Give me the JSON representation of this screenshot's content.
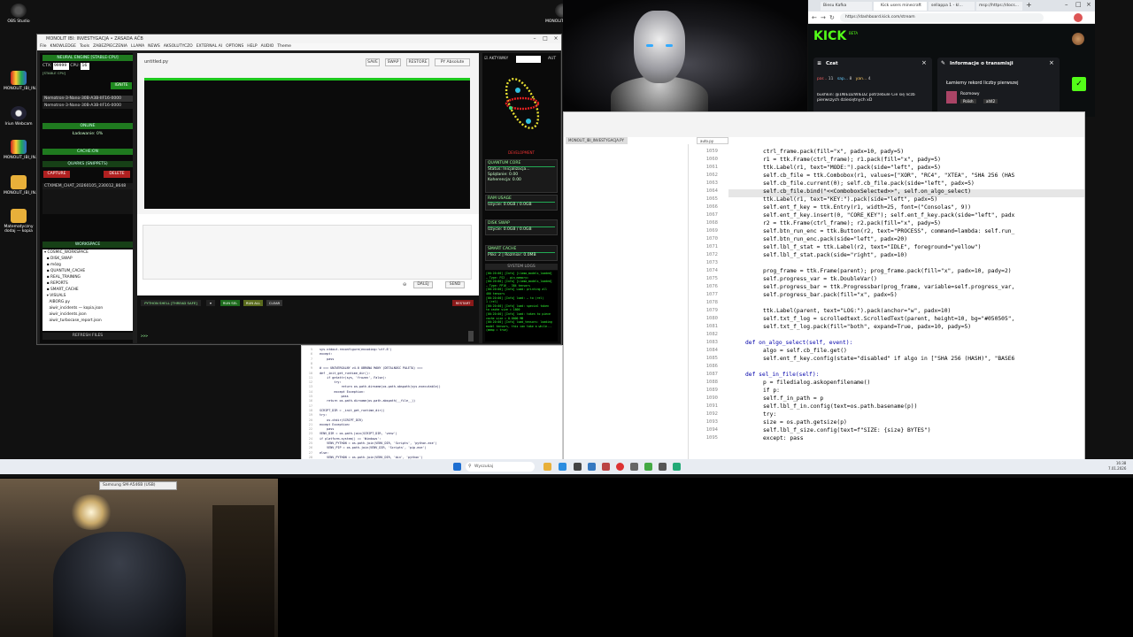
{
  "desktop": {
    "icons": [
      {
        "label": "OBS Studio"
      },
      {
        "label": "MONOLIT_IBI_IN..."
      },
      {
        "label": "Iriun Webcam"
      },
      {
        "label": "MONOLIT_IBI_IN..."
      },
      {
        "label": "MONOLIT_IBI_IN..."
      },
      {
        "label": "Matematyczny dodaj — kopia"
      }
    ],
    "top_icon": {
      "label": "MONOLIT_IBI_IN..."
    }
  },
  "app": {
    "title": "MONOLIT IBI: INVESTYGACJA • ZASADA AČB",
    "menu": [
      "File",
      "KNOWLEDGE",
      "Tools",
      "ZABEZPIECZENIA",
      "LLAMA",
      "NEWS",
      "AKSOLUTYCZO",
      "EXTERNAL AI",
      "OPTIONS",
      "HELP",
      "AUDIO",
      "Theme"
    ],
    "left": {
      "neural_engine": "NEURAL ENGINE [STABLE-CPU]",
      "ctx_label": "CTX:",
      "ctx_value": "99999",
      "cpu_label": "CPU:",
      "cpu_value": "16",
      "stable": "[STABLE CPU]",
      "ignite": "IGNITE",
      "models": [
        "Nemotron-3-Nano-30B-A3B-IIF16-0000",
        "Nemotron-3-Nano-30B-A3B-IIF16-0000"
      ],
      "online": "ONLINE",
      "loading": "Ładowanie: 0%",
      "cache_on": "CACHE:ON",
      "quarks": "QUARKS (SNIPPETS)",
      "capture": "CAPTURE",
      "delete": "DELETE",
      "snippet": "CTXMEM_CHAT_20260105_230012_8648",
      "workspace": "WORKSPACE",
      "tree": [
        "▾ COSMIC_WORKSPACE",
        "  ▪ DISK_SWAP",
        "  ▪ mózg",
        "  ▪ QUANTUM_CACHE",
        "  ▪ REAL_TRAINING",
        "  ▪ REPORTS",
        "  ▪ SMART_CACHE",
        "  ▾ VISUALS",
        "    AIBORG.py",
        "    aiwir_incidents — kopia.json",
        "    aiwir_incidents.json",
        "    aiwir_turbocase_report.json"
      ],
      "refresh": "REFRESH FILES"
    },
    "center": {
      "filename": "untitled.py",
      "buttons": [
        "SAVE",
        "SWAP",
        "RESTORE",
        "PY Absolute"
      ],
      "dalej": "DALEJ",
      "send": "SEND",
      "shell": "PYTHON SHELL [THREAD SAFE]",
      "run_sel": "RUN SEL",
      "run_all": "RUN ALL",
      "clear": "CLEAR",
      "restart": "RESTART",
      "prompt": ">>>"
    },
    "right": {
      "aktywny": "AKTYWNY",
      "aut": "AUT",
      "dev": "DEVELOPMENT",
      "quantum": "QUANTUM CORE",
      "status": "Status: Inicjalizacja...",
      "splatanie": "Splątanie: 0.00",
      "koherencja": "Koherencja: 0.00",
      "ram": "RAM USAGE",
      "ram_val": "Użycie: 0.0GB / 0.0GB",
      "disk": "DISK SWAP",
      "disk_val": "Użycie: 0.0GB / 0.0GB",
      "smart": "SMART CACHE",
      "smart_val": "Pliki: 2 | Rozmiar: 0.0MB",
      "syslog": "SYSTEM LOGS",
      "logs": [
        "[00:20:00] [Info] [Llama_models_loaded]",
        "— Type: FS2 - pin_memory=",
        "[00:20:00] [Info] [Llama_models_loaded]",
        "— Type: FP16 - 384 tensors",
        "[00:20:00] [Info] Load: printing all",
        "400 tensors",
        "[00:20:00] [Info] load: — to (rel)",
        "1 (rel)",
        "[00:20:00] [Info] load: special token",
        "to cache size = 1800",
        "[00:20:00] [Info] load: token to piece",
        "cache size = 0.0000 MB",
        "[00:20:00] [Info] load_tensors: loading",
        "model tensors, this can take a while...",
        "(mmap = true)"
      ]
    }
  },
  "browser": {
    "tabs": [
      "Biesu Kafka",
      "Kick users minecraft",
      "sellappa 1 - kl...",
      "msp://https://docs..."
    ],
    "url": "https://dashboard.kick.com/stream",
    "brand": "KICK",
    "beta": "BETA",
    "chat": "Czat",
    "info": "Informacje o transmisji",
    "chat_users": [
      "par...",
      "11",
      "sap...",
      "8",
      "yan...",
      "4"
    ],
    "chat_msg": "bushkin: @1NIEDZWIEDZ potrzebule Cie się liczb pierwszych dziesiętnych xD",
    "stream_title": "Łamiemy rekord liczby pierwszej",
    "category": "Rozmowy",
    "tag1": "Polish",
    "tag2": "alt42"
  },
  "code": {
    "tab1": "MONOLIT_IBI_INVESTYGACJA.PY",
    "tab2": "auto.py",
    "lines": [
      {
        "n": "1059",
        "t": "ctrl_frame.pack(fill=\"x\", padx=10, pady=5)"
      },
      {
        "n": "1060",
        "t": "r1 = ttk.Frame(ctrl_frame); r1.pack(fill=\"x\", pady=5)"
      },
      {
        "n": "1061",
        "t": "ttk.Label(r1, text=\"MODE:\").pack(side=\"left\", padx=5)"
      },
      {
        "n": "1062",
        "t": "self.cb_file = ttk.Combobox(r1, values=[\"XOR\", \"RC4\", \"XTEA\", \"SHA 256 (HAS"
      },
      {
        "n": "1063",
        "t": "self.cb_file.current(0); self.cb_file.pack(side=\"left\", padx=5)"
      },
      {
        "n": "1064",
        "t": "self.cb_file.bind(\"<<ComboboxSelected>>\", self.on_algo_select)"
      },
      {
        "n": "1065",
        "t": "ttk.Label(r1, text=\"KEY:\").pack(side=\"left\", padx=5)"
      },
      {
        "n": "1066",
        "t": "self.ent_f_key = ttk.Entry(r1, width=25, font=(\"Consolas\", 9))"
      },
      {
        "n": "1067",
        "t": "self.ent_f_key.insert(0, \"CORE_KEY\"); self.ent_f_key.pack(side=\"left\", padx"
      },
      {
        "n": "1068",
        "t": "r2 = ttk.Frame(ctrl_frame); r2.pack(fill=\"x\", pady=5)"
      },
      {
        "n": "1069",
        "t": "self.btn_run_enc = ttk.Button(r2, text=\"PROCESS\", command=lambda: self.run_"
      },
      {
        "n": "1070",
        "t": "self.btn_run_enc.pack(side=\"left\", padx=20)"
      },
      {
        "n": "1071",
        "t": "self.lbl_f_stat = ttk.Label(r2, text=\"IDLE\", foreground=\"yellow\")"
      },
      {
        "n": "1072",
        "t": "self.lbl_f_stat.pack(side=\"right\", padx=10)"
      },
      {
        "n": "1073",
        "t": ""
      },
      {
        "n": "1074",
        "t": "prog_frame = ttk.Frame(parent); prog_frame.pack(fill=\"x\", padx=10, pady=2)"
      },
      {
        "n": "1075",
        "t": "self.progress_var = tk.DoubleVar()"
      },
      {
        "n": "1076",
        "t": "self.progress_bar = ttk.Progressbar(prog_frame, variable=self.progress_var,"
      },
      {
        "n": "1077",
        "t": "self.progress_bar.pack(fill=\"x\", padx=5)"
      },
      {
        "n": "1078",
        "t": ""
      },
      {
        "n": "1079",
        "t": "ttk.Label(parent, text=\"LOG:\").pack(anchor=\"w\", padx=10)"
      },
      {
        "n": "1080",
        "t": "self.txt_f_log = scrolledtext.ScrolledText(parent, height=10, bg=\"#050505\","
      },
      {
        "n": "1081",
        "t": "self.txt_f_log.pack(fill=\"both\", expand=True, padx=10, pady=5)"
      },
      {
        "n": "1082",
        "t": ""
      },
      {
        "n": "1083",
        "t": "def on_algo_select(self, event):"
      },
      {
        "n": "1084",
        "t": "    algo = self.cb_file.get()"
      },
      {
        "n": "1085",
        "t": "    self.ent_f_key.config(state=\"disabled\" if algo in [\"SHA 256 (HASH)\", \"BASE6"
      },
      {
        "n": "1086",
        "t": ""
      },
      {
        "n": "1087",
        "t": "def sel_in_file(self):"
      },
      {
        "n": "1088",
        "t": "    p = filedialog.askopenfilename()"
      },
      {
        "n": "1089",
        "t": "    if p:"
      },
      {
        "n": "1090",
        "t": "        self.f_in_path = p"
      },
      {
        "n": "1091",
        "t": "        self.lbl_f_in.config(text=os.path.basename(p))"
      },
      {
        "n": "1092",
        "t": "        try:"
      },
      {
        "n": "1093",
        "t": "            size = os.path.getsize(p)"
      },
      {
        "n": "1094",
        "t": "            self.lbl_f_size.config(text=f\"SIZE: {size} BYTES\")"
      },
      {
        "n": "1095",
        "t": "        except: pass"
      }
    ]
  },
  "code2": {
    "lines": [
      "sys.stdout.reconfigure(encoding='utf-8')",
      "except:",
      "    pass",
      "",
      "# === UNIVERSALNY v4.0 OBRONA MANY (DETALNOŚĆ PALETA) ===",
      "def _init_get_runtime_dir():",
      "    if getattr(sys, 'frozen', False):",
      "        try:",
      "            return os.path.dirname(os.path.abspath(sys.executable))",
      "        except Exception:",
      "            pass",
      "    return os.path.dirname(os.path.abspath(__file__))",
      "",
      "SCRIPT_DIR = _init_get_runtime_dir()",
      "try:",
      "    os.chdir(SCRIPT_DIR)",
      "except Exception:",
      "    pass",
      "VENV_DIR = os.path.join(SCRIPT_DIR, 'venv')",
      "if platform.system() == 'Windows':",
      "    VENV_PYTHON = os.path.join(VENV_DIR, 'Scripts', 'python.exe')",
      "    VENV_PIP = os.path.join(VENV_DIR, 'Scripts', 'pip.exe')",
      "else:",
      "    VENV_PYTHON = os.path.join(VENV_DIR, 'bin', 'python')"
    ],
    "nums": [
      "5",
      "6",
      "7",
      "8",
      "9",
      "10",
      "11",
      "12",
      "13",
      "14",
      "15",
      "16",
      "17",
      "18",
      "19",
      "20",
      "21",
      "22",
      "23",
      "24",
      "25",
      "26",
      "27",
      "28"
    ]
  },
  "taskbar": {
    "search": "Wyszukaj",
    "time": "16:38",
    "date": "7.01.2026"
  },
  "webcam": {
    "label": "Samsung SM-A546B (USB)"
  }
}
